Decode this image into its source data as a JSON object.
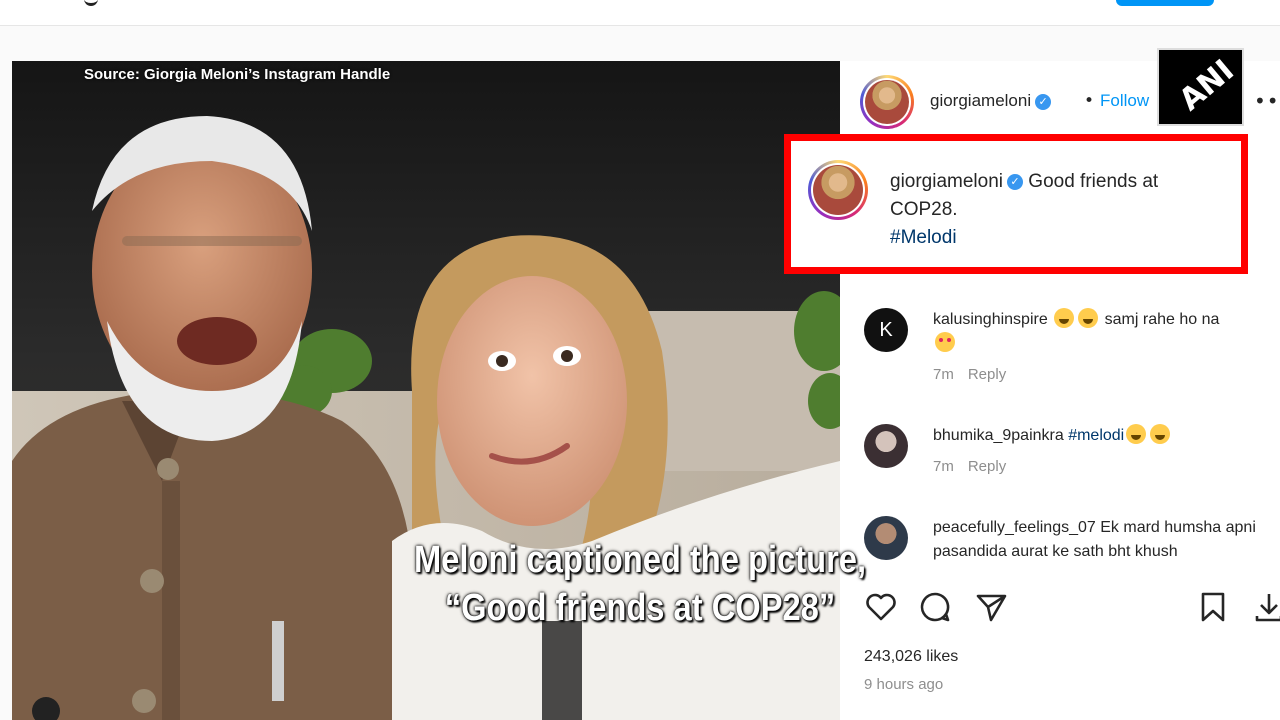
{
  "overlay": {
    "source_caption": "Source: Giorgia Meloni’s Instagram Handle",
    "subtitle_line1": "Meloni captioned the picture,",
    "subtitle_line2": "“Good friends at COP28”",
    "watermark": "ANI"
  },
  "post": {
    "username": "giorgiameloni",
    "separator": "•",
    "follow_label": "Follow",
    "more_icon": "more-horizontal-icon",
    "caption_text": "Good friends at COP28.",
    "caption_hashtag": "#Melodi",
    "highlight_color": "#ff0000",
    "link_color": "#0095f6"
  },
  "comments": [
    {
      "username": "kalusinghinspire",
      "text": "samj rahe ho na",
      "time": "7m",
      "reply": "Reply",
      "avatar_letter": "K"
    },
    {
      "username": "bhumika_9painkra",
      "hashtag": "#melodi",
      "time": "7m",
      "reply": "Reply"
    },
    {
      "username": "peacefully_feelings_07",
      "text": "Ek mard humsha apni pasandida aurat ke sath bht khush"
    }
  ],
  "actions": {
    "icons": [
      "heart-icon",
      "comment-icon",
      "share-icon",
      "bookmark-icon",
      "download-icon"
    ]
  },
  "stats": {
    "likes": "243,026 likes",
    "posted": "9 hours ago"
  }
}
